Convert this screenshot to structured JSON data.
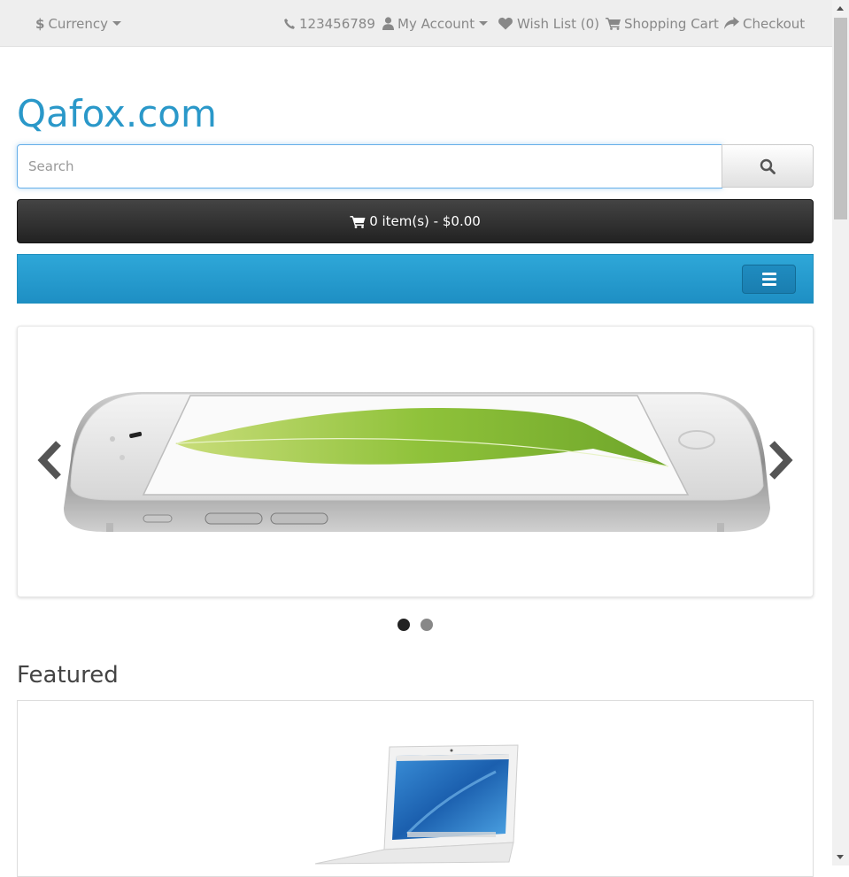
{
  "topbar": {
    "currency_label": "Currency",
    "currency_symbol": "$",
    "phone": "123456789",
    "my_account": "My Account",
    "wish_list": "Wish List (0)",
    "shopping_cart": "Shopping Cart",
    "checkout": "Checkout"
  },
  "header": {
    "logo": "Qafox.com"
  },
  "search": {
    "placeholder": "Search",
    "value": ""
  },
  "cart": {
    "summary": "0 item(s) - $0.00"
  },
  "slider": {
    "slide_count": 2,
    "active_slide": 1
  },
  "featured": {
    "title": "Featured"
  },
  "colors": {
    "brand": "#2a98c9",
    "menu_bar": "#229ac8",
    "cart_button": "#303030"
  },
  "icons": [
    "dollar-icon",
    "phone-icon",
    "user-icon",
    "heart-icon",
    "cart-icon",
    "share-icon",
    "search-icon",
    "hamburger-icon",
    "chevron-left-icon",
    "chevron-right-icon"
  ]
}
